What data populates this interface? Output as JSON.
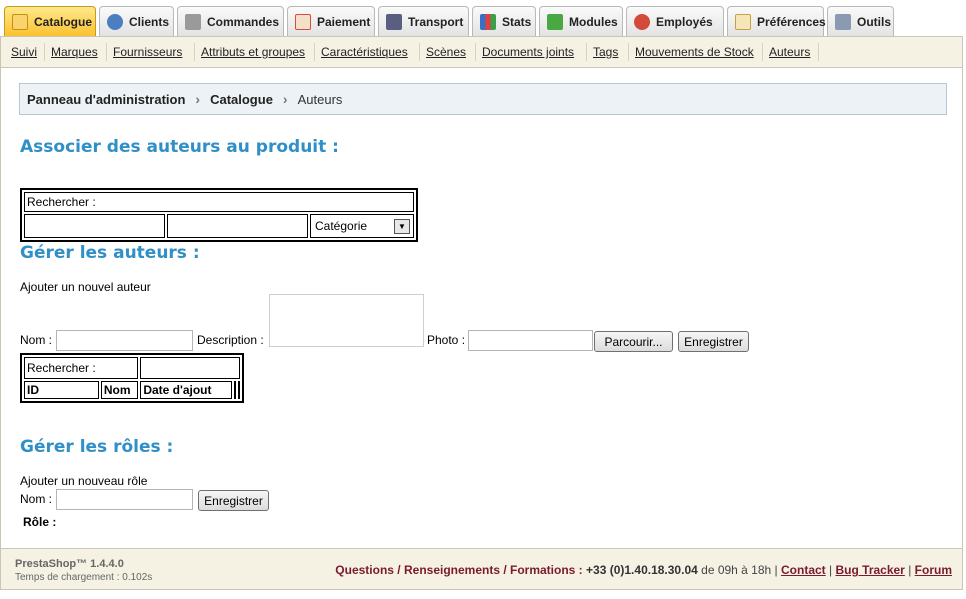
{
  "tabs": [
    {
      "label": "Catalogue",
      "icon": "catalogue-icon",
      "color": "#f2b21a"
    },
    {
      "label": "Clients",
      "icon": "clients-icon",
      "color": "#4b7fc0"
    },
    {
      "label": "Commandes",
      "icon": "cart-icon",
      "color": "#8a8a8a"
    },
    {
      "label": "Paiement",
      "icon": "payment-icon",
      "color": "#d94b3a"
    },
    {
      "label": "Transport",
      "icon": "truck-icon",
      "color": "#555a7a"
    },
    {
      "label": "Stats",
      "icon": "chart-icon",
      "color": "#3a6fc4"
    },
    {
      "label": "Modules",
      "icon": "puzzle-icon",
      "color": "#4aa843"
    },
    {
      "label": "Employés",
      "icon": "employee-icon",
      "color": "#d24a3a"
    },
    {
      "label": "Préférences",
      "icon": "preferences-icon",
      "color": "#e0a030"
    },
    {
      "label": "Outils",
      "icon": "tools-icon",
      "color": "#7a8aa0"
    }
  ],
  "subnav": [
    "Suivi",
    "Marques",
    "Fournisseurs",
    "Attributs et groupes",
    "Caractéristiques",
    "Scènes",
    "Documents joints",
    "Tags",
    "Mouvements de Stock",
    "Auteurs"
  ],
  "breadcrumb": {
    "root": "Panneau d'administration",
    "section": "Catalogue",
    "current": "Auteurs"
  },
  "associate": {
    "title": "Associer des auteurs au produit :",
    "search_label": "Rechercher :",
    "category_value": "Catégorie"
  },
  "manage_authors": {
    "title": "Gérer les auteurs :",
    "add_label": "Ajouter un nouvel auteur",
    "name_label": "Nom :",
    "description_label": "Description :",
    "photo_label": "Photo :",
    "browse_button": "Parcourir...",
    "save_button": "Enregistrer",
    "search_label": "Rechercher :",
    "columns": [
      "ID",
      "Nom",
      "Date d'ajout"
    ]
  },
  "manage_roles": {
    "title": "Gérer les rôles :",
    "add_label": "Ajouter un nouveau rôle",
    "name_label": "Nom :",
    "save_button": "Enregistrer",
    "role_label": "Rôle :"
  },
  "footer": {
    "version": "PrestaShop™ 1.4.4.0",
    "load_time": "Temps de chargement : 0.102s",
    "questions": "Questions / Renseignements / Formations :",
    "phone": "+33 (0)1.40.18.30.04",
    "hours": "de 09h à 18h",
    "contact": "Contact",
    "bug_tracker": "Bug Tracker",
    "forum": "Forum"
  }
}
